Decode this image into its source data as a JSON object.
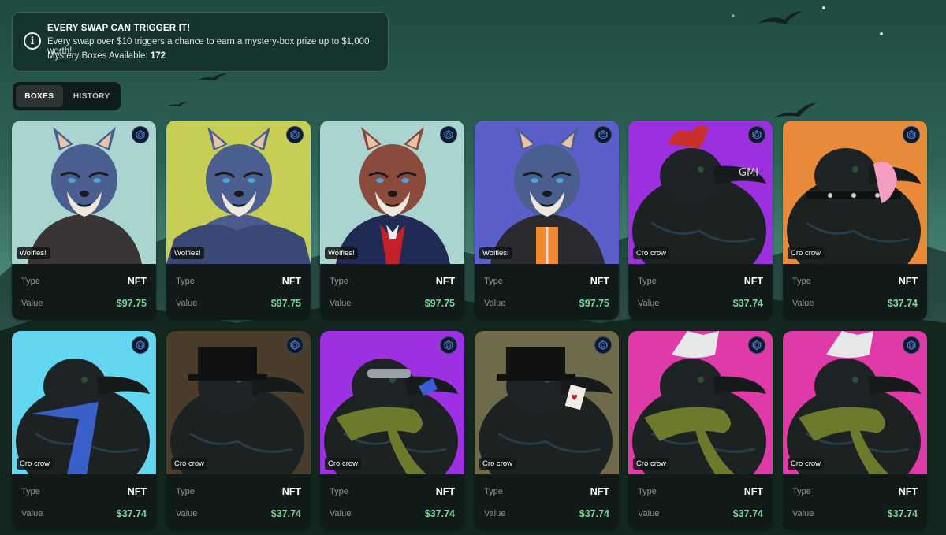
{
  "banner": {
    "title": "EVERY SWAP CAN TRIGGER IT!",
    "description": "Every swap over $10 triggers a chance to earn a mystery-box prize up to $1,000 worth!",
    "available_label": "Mystery Boxes Available:",
    "available_count": "172"
  },
  "tabs": [
    {
      "label": "BOXES",
      "active": true
    },
    {
      "label": "HISTORY",
      "active": false
    }
  ],
  "card_labels": {
    "type": "Type",
    "value": "Value"
  },
  "chain_icon": "cronos-chain-icon",
  "cards": [
    {
      "collection": "Wolfies!",
      "type": "NFT",
      "value": "$97.75",
      "bg": "#a9d4d0",
      "subject": "wolf-leather-jacket"
    },
    {
      "collection": "Wolfies!",
      "type": "NFT",
      "value": "$97.75",
      "bg": "#c6cf53",
      "subject": "wolf-fur-coat"
    },
    {
      "collection": "Wolfies!",
      "type": "NFT",
      "value": "$97.75",
      "bg": "#a9d4d0",
      "subject": "wolf-vampire"
    },
    {
      "collection": "Wolfies!",
      "type": "NFT",
      "value": "$97.75",
      "bg": "#5b5fc9",
      "subject": "wolf-ninja-jacket"
    },
    {
      "collection": "Cro crow",
      "type": "NFT",
      "value": "$37.74",
      "bg": "#9c2fe0",
      "subject": "crow-rooster-gmi"
    },
    {
      "collection": "Cro crow",
      "type": "NFT",
      "value": "$37.74",
      "bg": "#e98a3a",
      "subject": "crow-spiked-collar"
    },
    {
      "collection": "Cro crow",
      "type": "NFT",
      "value": "$37.74",
      "bg": "#63d7f0",
      "subject": "crow-blue-tie"
    },
    {
      "collection": "Cro crow",
      "type": "NFT",
      "value": "$37.74",
      "bg": "#4a3d2c",
      "subject": "crow-top-hat"
    },
    {
      "collection": "Cro crow",
      "type": "NFT",
      "value": "$37.74",
      "bg": "#9d30e3",
      "subject": "crow-green-scarf"
    },
    {
      "collection": "Cro crow",
      "type": "NFT",
      "value": "$37.74",
      "bg": "#6f6a4a",
      "subject": "crow-top-hat-card"
    },
    {
      "collection": "Cro crow",
      "type": "NFT",
      "value": "$37.74",
      "bg": "#e03aa8",
      "subject": "crow-foil-hat-scarf"
    },
    {
      "collection": "Cro crow",
      "type": "NFT",
      "value": "$37.74",
      "bg": "#e03aa8",
      "subject": "crow-foil-hat-scarf"
    }
  ]
}
